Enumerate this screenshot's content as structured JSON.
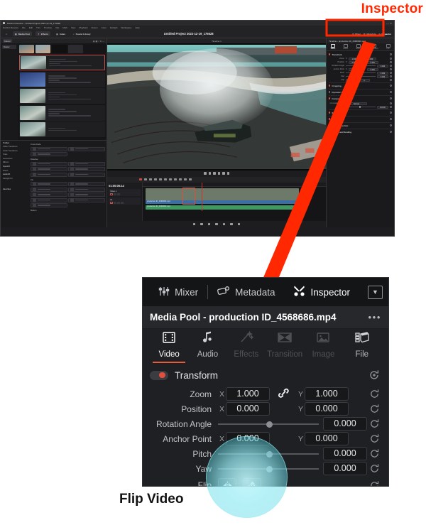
{
  "annotations": {
    "inspector_label": "Inspector",
    "flip_label": "Flip Video",
    "accent_red": "#ff2800",
    "glow_color": "#8fe8f2"
  },
  "resolve_window": {
    "titlebar": "DaVinci Resolve - Untitled Project 2022-12-19_175628",
    "menus": [
      "DaVinci Resolve",
      "File",
      "Edit",
      "Trim",
      "Timeline",
      "Clip",
      "Mark",
      "View",
      "Playback",
      "Fusion",
      "Color",
      "Fairlight",
      "Workspace",
      "Help"
    ],
    "toolbar": {
      "media_pool": "Media Pool",
      "effects": "Effects",
      "index": "Index",
      "sound_library": "Sound Library",
      "project_title": "Untitled Project 2022-12-19_175628",
      "project_suffix": "Edited",
      "right_tools": [
        "Mixer",
        "Metadata",
        "Inspector"
      ],
      "inspector_active": true
    },
    "media_pool": {
      "header": "Master",
      "bin": "Master",
      "smart_bins": [
        "Timeline 1",
        "lingthrough...",
        "Compound...",
        "2022-09-27 ..."
      ],
      "clips": [
        {
          "timecode": "00:00:00:00",
          "date": "2022-09-09",
          "name": "production ID_4568686.mp4",
          "selected": true
        },
        {
          "timecode": "00:00:00:00",
          "date": "2021-05-05",
          "name": "1080 hi Stock Footage City Dock Magenta..."
        },
        {
          "timecode": "00:00:00:00",
          "date": "2022-01-06",
          "name": "Fusion Clip 1"
        },
        {
          "timecode": "00:00:00:00",
          "date": "",
          "name": "Fusion Clip 2"
        },
        {
          "timecode": "00:00:00:00",
          "date": "",
          "name": ""
        }
      ]
    },
    "effects_library": {
      "title": "Toolbox",
      "tree": [
        "Toolbox",
        "Video Transitions",
        "Audio Transitions",
        "Titles",
        "Generators",
        "Effects",
        "OpenFX",
        "Filters",
        "AudioFX",
        "Fairlight FX",
        "Favorites"
      ],
      "sections": [
        {
          "name": "Cross Fade",
          "items": [
            "Cross Fade -3 dB",
            "Cross Fade -6 dB",
            "Cross Fade 0 dB"
          ]
        },
        {
          "name": "Dissolve",
          "items": [
            "Additive Dissolve",
            "Blur Dissolve",
            "Cross Dissolve",
            "Dip To Color Dissolve",
            "Non-Additive Dissolve",
            "Smooth Cut"
          ]
        },
        {
          "name": "Iris",
          "items": [
            "Arrow Iris",
            "Cross Iris",
            "Diamond Iris",
            "Eye Iris",
            "Hexagon Iris",
            "Oval Iris",
            "Pentagon Iris",
            "Square Iris",
            "Triangle Iris"
          ]
        },
        {
          "name": "Motion",
          "items": []
        }
      ]
    },
    "viewer": {
      "tab": "Timeline 1",
      "timecode_left": "01:00:06:14",
      "timecode_right": "00:00:08:14"
    },
    "timeline": {
      "timecode": "01:00:06:14",
      "tracks": [
        {
          "name": "Video 1",
          "clip_count": "1 Clip",
          "clips": [
            "production ID_4568686.mp4",
            "production ID_4568686.mp4"
          ]
        },
        {
          "name": "A1",
          "clips": [
            "production ID_4568686.mp4",
            "produc...",
            "production ID_4568686.mp4"
          ]
        }
      ],
      "ruler_marks": [
        "01:00:00:00",
        "01:00:05:00",
        "01:00:10:00",
        "01:00:15:00",
        "01:00:20:00"
      ]
    },
    "inspector_panel": {
      "title": "Timeline - production ID_4568686.mp4",
      "tabs": [
        "Video",
        "Audio",
        "Effects",
        "Transition",
        "File"
      ],
      "active_tab": "Video",
      "sections": [
        {
          "name": "Transform",
          "open": true
        },
        {
          "name": "Cropping",
          "open": false
        },
        {
          "name": "Dynamic Zoom",
          "open": false
        },
        {
          "name": "Composite",
          "open": true
        },
        {
          "name": "Speed Change",
          "open": false
        },
        {
          "name": "Stabilization",
          "open": false
        },
        {
          "name": "Lens Correction",
          "open": false
        },
        {
          "name": "Retime and Scaling",
          "open": false
        }
      ],
      "transform": {
        "zoom_x": "1.000",
        "zoom_y": "1.000",
        "position_x": "0.000",
        "position_y": "0.000",
        "rotation": "0.000",
        "anchor_x": "0.000",
        "anchor_y": "0.000",
        "pitch": "0.000",
        "yaw": "0.000"
      },
      "composite": {
        "mode_label": "Composite Mode",
        "mode_value": "Normal",
        "opacity_label": "Opacity",
        "opacity_value": "100.00"
      }
    }
  },
  "inspector_zoom": {
    "toolbar": {
      "mixer": "Mixer",
      "metadata": "Metadata",
      "inspector": "Inspector",
      "caret_icon": "chevron-down-icon"
    },
    "title": "Media Pool - production ID_4568686.mp4",
    "overflow": "•••",
    "tabs": [
      {
        "label": "Video",
        "icon": "film-strip-icon",
        "state": "active"
      },
      {
        "label": "Audio",
        "icon": "music-note-icon",
        "state": "enabled"
      },
      {
        "label": "Effects",
        "icon": "magic-wand-icon",
        "state": "disabled"
      },
      {
        "label": "Transition",
        "icon": "transition-icon",
        "state": "disabled"
      },
      {
        "label": "Image",
        "icon": "image-icon",
        "state": "disabled"
      },
      {
        "label": "File",
        "icon": "file-stack-icon",
        "state": "enabled"
      }
    ],
    "transform": {
      "section_label": "Transform",
      "enabled": true,
      "rows": [
        {
          "label": "Zoom",
          "type": "xy",
          "x": "1.000",
          "y": "1.000",
          "linked": true
        },
        {
          "label": "Position",
          "type": "xy",
          "x": "0.000",
          "y": "0.000",
          "linked": false
        },
        {
          "label": "Rotation Angle",
          "type": "slider",
          "value": "0.000",
          "knob_pct": 48
        },
        {
          "label": "Anchor Point",
          "type": "xy",
          "x": "0.000",
          "y": "0.000",
          "linked": false
        },
        {
          "label": "Pitch",
          "type": "slider",
          "value": "0.000",
          "knob_pct": 48
        },
        {
          "label": "Yaw",
          "type": "slider",
          "value": "0.000",
          "knob_pct": 48
        },
        {
          "label": "Flip",
          "type": "flip",
          "buttons": [
            "flip-horizontal-icon",
            "flip-vertical-icon"
          ]
        }
      ]
    }
  }
}
